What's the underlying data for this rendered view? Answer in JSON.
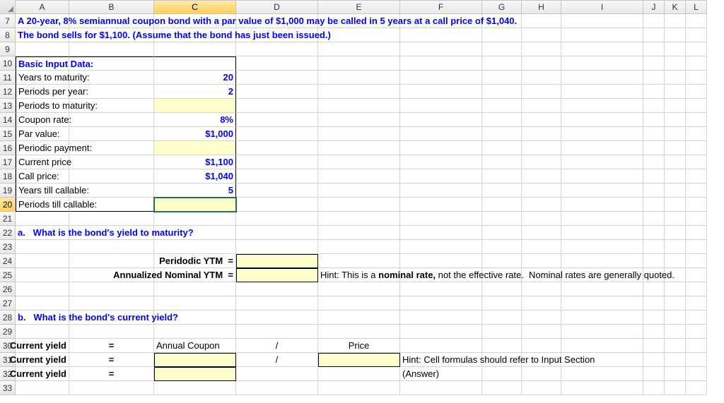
{
  "columns": [
    "A",
    "B",
    "C",
    "D",
    "E",
    "F",
    "G",
    "H",
    "I",
    "J",
    "K",
    "L"
  ],
  "rows": [
    "7",
    "8",
    "9",
    "10",
    "11",
    "12",
    "13",
    "14",
    "15",
    "16",
    "17",
    "18",
    "19",
    "20",
    "21",
    "22",
    "23",
    "24",
    "25",
    "26",
    "27",
    "28",
    "29",
    "30",
    "31",
    "32",
    "33"
  ],
  "selectedCol": "C",
  "selectedRow": "20",
  "text": {
    "r7": "A 20-year, 8% semiannual coupon bond with a par value of $1,000 may be called in 5 years at a call price of $1,040.",
    "r8": "The bond sells for $1,100. (Assume that the bond has just been issued.)",
    "r10": "Basic Input Data:",
    "r11a": "Years to maturity:",
    "r11c": "20",
    "r12a": "Periods per year:",
    "r12c": "2",
    "r13a": "Periods to maturity:",
    "r14a": "Coupon rate:",
    "r14c": "8%",
    "r15a": "Par value:",
    "r15c": "$1,000",
    "r16a": "Periodic payment:",
    "r17a": "Current price",
    "r17c": "$1,100",
    "r18a": "Call price:",
    "r18c": "$1,040",
    "r19a": "Years till callable:",
    "r19c": "5",
    "r20a": "Periods till callable:",
    "r22": "a.   What is the bond's yield to maturity?",
    "r24c": "Peridodic YTM  =",
    "r25c": "Annualized Nominal YTM  =",
    "r25hint_pre": "Hint: This is a ",
    "r25hint_bold": "nominal rate,",
    "r25hint_post": " not the effective rate.  Nominal rates are generally quoted.",
    "r28": "b.   What is the bond's current yield?",
    "r30a": "Current yield",
    "r30eq": "=",
    "r30c": "Annual Coupon",
    "r30d": "/",
    "r30e": "Price",
    "r31a": "Current yield",
    "r31eq": "=",
    "r31d": "/",
    "r31hint": "Hint: Cell formulas should refer to Input Section",
    "r32a": "Current yield",
    "r32eq": "=",
    "r32f": "(Answer)"
  }
}
